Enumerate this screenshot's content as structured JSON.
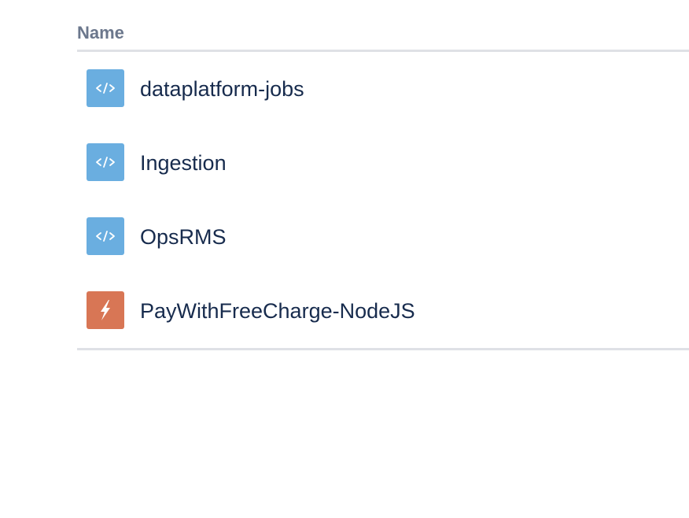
{
  "table": {
    "column_name": "Name",
    "rows": [
      {
        "name": "dataplatform-jobs",
        "icon": "code-icon",
        "icon_color": "#6aaee0"
      },
      {
        "name": "Ingestion",
        "icon": "code-icon",
        "icon_color": "#6aaee0"
      },
      {
        "name": "OpsRMS",
        "icon": "code-icon",
        "icon_color": "#6aaee0"
      },
      {
        "name": "PayWithFreeCharge-NodeJS",
        "icon": "lightning-icon",
        "icon_color": "#d87655"
      }
    ]
  }
}
